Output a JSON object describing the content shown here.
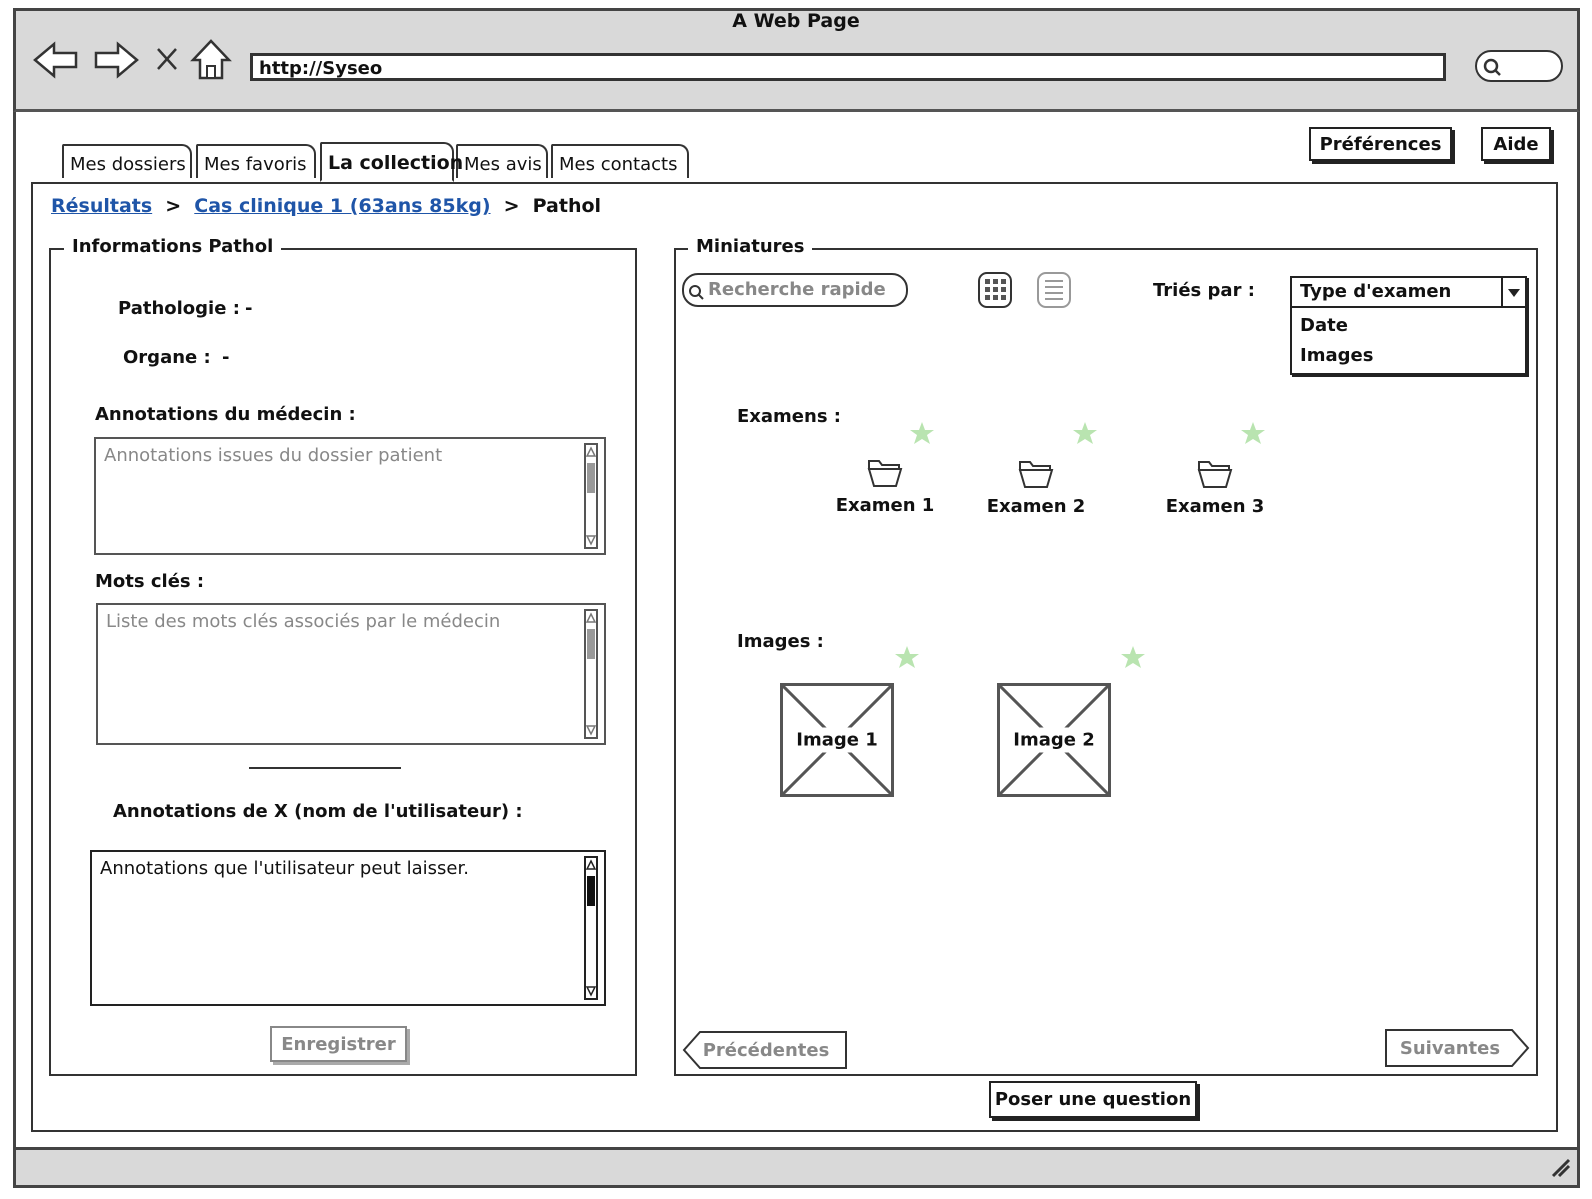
{
  "window": {
    "title": "A Web Page",
    "url": "http://Syseo"
  },
  "header": {
    "preferences_label": "Préférences",
    "help_label": "Aide"
  },
  "tabs": [
    {
      "label": "Mes dossiers",
      "active": false
    },
    {
      "label": "Mes favoris",
      "active": false
    },
    {
      "label": "La collection",
      "active": true
    },
    {
      "label": "Mes avis",
      "active": false
    },
    {
      "label": "Mes contacts",
      "active": false
    }
  ],
  "breadcrumb": {
    "items": [
      "Résultats",
      "Cas clinique 1 (63ans 85kg)",
      "Pathol"
    ],
    "separator": ">"
  },
  "info_panel": {
    "legend": "Informations Pathol",
    "pathologie_label": "Pathologie :",
    "pathologie_value": "-",
    "organe_label": "Organe :",
    "organe_value": "-",
    "annotations_medecin_label": "Annotations du médecin :",
    "annotations_medecin_placeholder": "Annotations issues du dossier patient",
    "mots_cles_label": "Mots clés :",
    "mots_cles_placeholder": "Liste des mots clés associés par le médecin",
    "annotations_user_label": "Annotations de X (nom de l'utilisateur) :",
    "annotations_user_value": "Annotations que l'utilisateur peut laisser.",
    "save_label": "Enregistrer"
  },
  "thumbs_panel": {
    "legend": "Miniatures",
    "search_placeholder": "Recherche rapide",
    "sort_label": "Triés par :",
    "sort_selected": "Type d'examen",
    "sort_options": [
      "Date",
      "Images"
    ],
    "exams_label": "Examens :",
    "exams": [
      "Examen 1",
      "Examen 2",
      "Examen 3"
    ],
    "images_label": "Images :",
    "images": [
      "Image 1",
      "Image 2"
    ],
    "prev_label": "Précédentes",
    "next_label": "Suivantes"
  },
  "ask_label": "Poser une question",
  "colors": {
    "star": "#b9e4b0",
    "link": "#1f55a8",
    "chrome": "#d9d9d9"
  }
}
